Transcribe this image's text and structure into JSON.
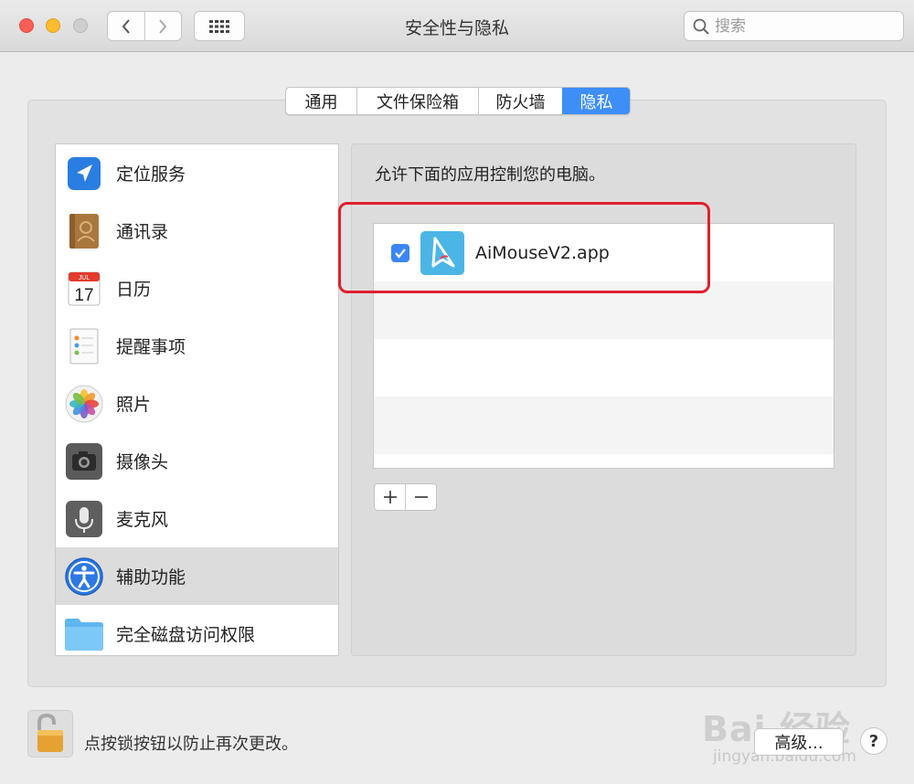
{
  "window": {
    "title": "安全性与隐私",
    "search_placeholder": "搜索"
  },
  "tabs": [
    {
      "label": "通用",
      "active": false
    },
    {
      "label": "文件保险箱",
      "active": false
    },
    {
      "label": "防火墙",
      "active": false
    },
    {
      "label": "隐私",
      "active": true
    }
  ],
  "sidebar": {
    "items": [
      {
        "label": "定位服务",
        "icon": "location-arrow-icon"
      },
      {
        "label": "通讯录",
        "icon": "contacts-book-icon"
      },
      {
        "label": "日历",
        "icon": "calendar-icon",
        "icon_month": "JUL",
        "icon_day": "17"
      },
      {
        "label": "提醒事项",
        "icon": "reminders-icon"
      },
      {
        "label": "照片",
        "icon": "photos-icon"
      },
      {
        "label": "摄像头",
        "icon": "camera-icon"
      },
      {
        "label": "麦克风",
        "icon": "microphone-icon"
      },
      {
        "label": "辅助功能",
        "icon": "accessibility-icon",
        "selected": true
      },
      {
        "label": "完全磁盘访问权限",
        "icon": "folder-icon"
      }
    ]
  },
  "main": {
    "heading": "允许下面的应用控制您的电脑。",
    "apps": [
      {
        "name": "AiMouseV2.app",
        "checked": true,
        "icon": "aimouse-app-icon"
      }
    ]
  },
  "footer": {
    "lock_text": "点按锁按钮以防止再次更改。",
    "advanced_label": "高级...",
    "help_label": "?"
  },
  "watermark": {
    "line1": "Bai 经验",
    "line2": "jingyan.baidu.com"
  },
  "colors": {
    "accent": "#3d8ef7",
    "highlight_box": "#e0202c"
  }
}
